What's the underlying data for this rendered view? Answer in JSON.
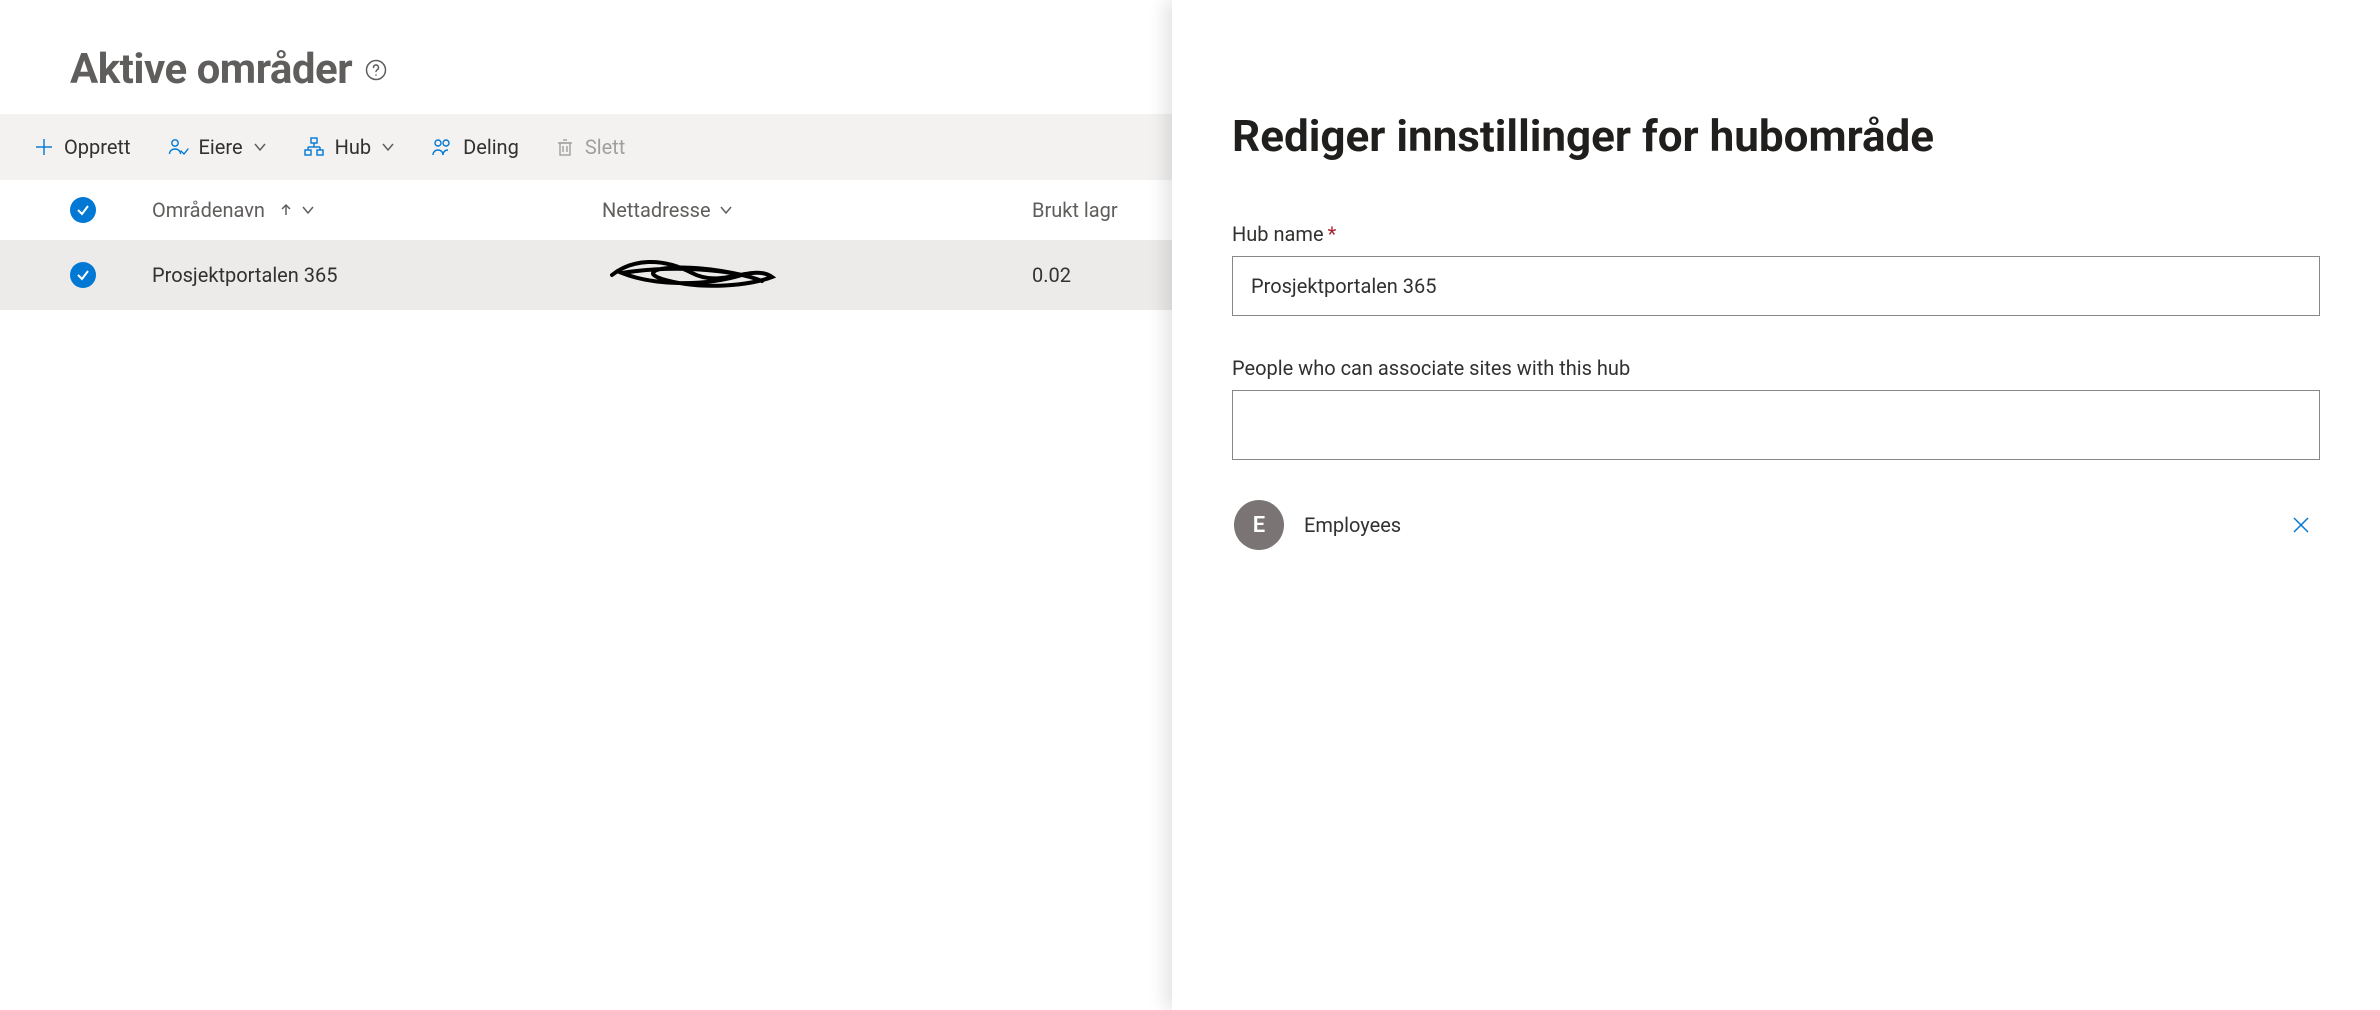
{
  "header": {
    "title": "Aktive områder"
  },
  "toolbar": {
    "create": "Opprett",
    "owners": "Eiere",
    "hub": "Hub",
    "sharing": "Deling",
    "delete": "Slett"
  },
  "table": {
    "columns": {
      "name": "Områdenavn",
      "url": "Nettadresse",
      "storage": "Brukt lagr"
    },
    "rows": [
      {
        "name": "Prosjektportalen 365",
        "url_redacted": true,
        "storage": "0.02"
      }
    ]
  },
  "panel": {
    "title": "Rediger innstillinger for hubområde",
    "hub_name_label": "Hub name",
    "hub_name_value": "Prosjektportalen 365",
    "people_label": "People who can associate sites with this hub",
    "people": [
      {
        "initial": "E",
        "name": "Employees"
      }
    ]
  }
}
